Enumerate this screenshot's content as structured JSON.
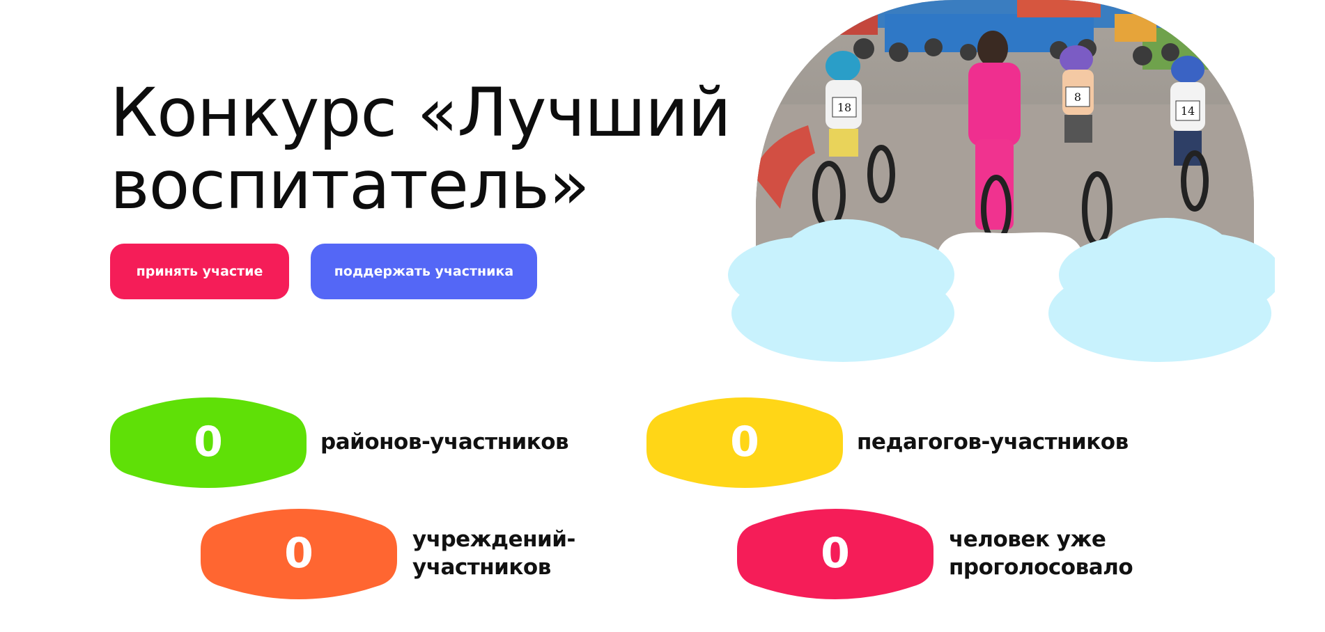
{
  "hero": {
    "title_line1": "Конкурс «Лучший",
    "title_line2": "воспитатель»",
    "participate_label": "принять участие",
    "support_label": "поддержать участника",
    "photo_bib_numbers": [
      "18",
      "8",
      "14"
    ]
  },
  "colors": {
    "primary_button": "#f51d58",
    "secondary_button": "#5467f6",
    "cloud": "#c8f2fd",
    "green": "#5fe007",
    "yellow": "#ffd617",
    "orange": "#ff6631",
    "pink": "#f51d58"
  },
  "stats": [
    {
      "value": "0",
      "label_line1": "районов-участников",
      "label_line2": "",
      "color": "#5fe007"
    },
    {
      "value": "0",
      "label_line1": "педагогов-участников",
      "label_line2": "",
      "color": "#ffd617"
    },
    {
      "value": "0",
      "label_line1": "учреждений-",
      "label_line2": "участников",
      "color": "#ff6631"
    },
    {
      "value": "0",
      "label_line1": "человек уже",
      "label_line2": "проголосовало",
      "color": "#f51d58"
    }
  ]
}
